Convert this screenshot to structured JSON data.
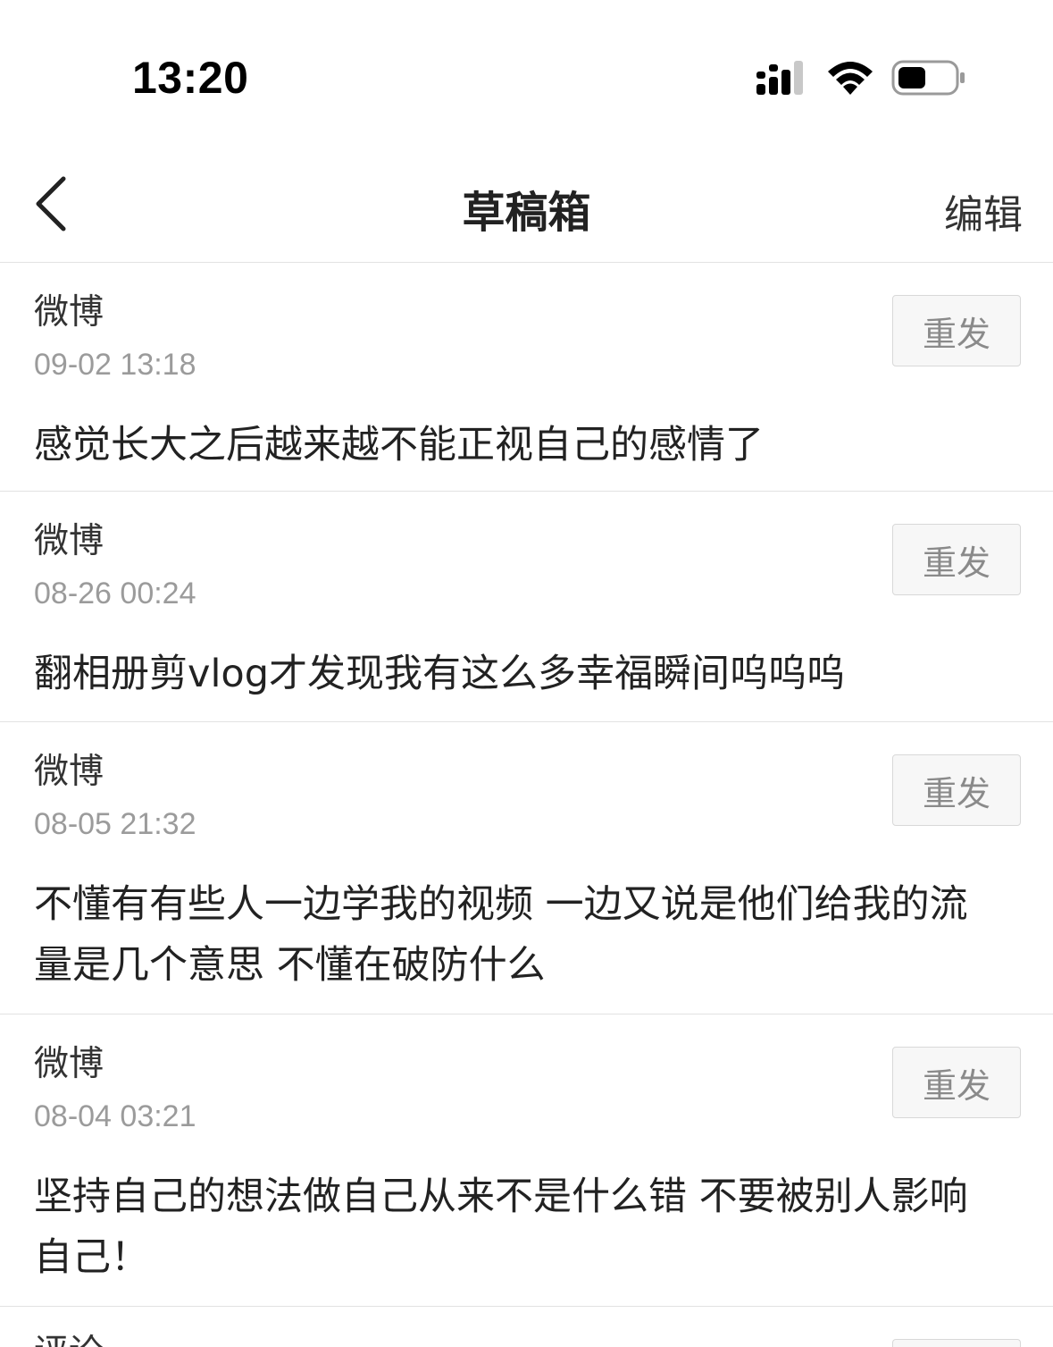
{
  "status_bar": {
    "time": "13:20"
  },
  "nav": {
    "title": "草稿箱",
    "edit_label": "编辑"
  },
  "drafts": [
    {
      "source": "微博",
      "time": "09-02 13:18",
      "content": "感觉长大之后越来越不能正视自己的感情了",
      "resend_label": "重发"
    },
    {
      "source": "微博",
      "time": "08-26 00:24",
      "content": "翻相册剪vlog才发现我有这么多幸福瞬间呜呜呜",
      "resend_label": "重发"
    },
    {
      "source": "微博",
      "time": "08-05 21:32",
      "content": "不懂有有些人一边学我的视频 一边又说是他们给我的流量是几个意思 不懂在破防什么",
      "resend_label": "重发"
    },
    {
      "source": "微博",
      "time": "08-04 03:21",
      "content": "坚持自己的想法做自己从来不是什么错 不要被别人影响自己！",
      "resend_label": "重发"
    }
  ],
  "partial_item": {
    "source": "评论"
  },
  "icons": {
    "back": "chevron-left-icon",
    "signal": "cellular-signal-icon",
    "wifi": "wifi-icon",
    "battery": "battery-icon"
  },
  "colors": {
    "text": "#222222",
    "muted": "#9b9b9b",
    "divider": "#e2e2e2",
    "button_bg": "#f7f7f7"
  }
}
